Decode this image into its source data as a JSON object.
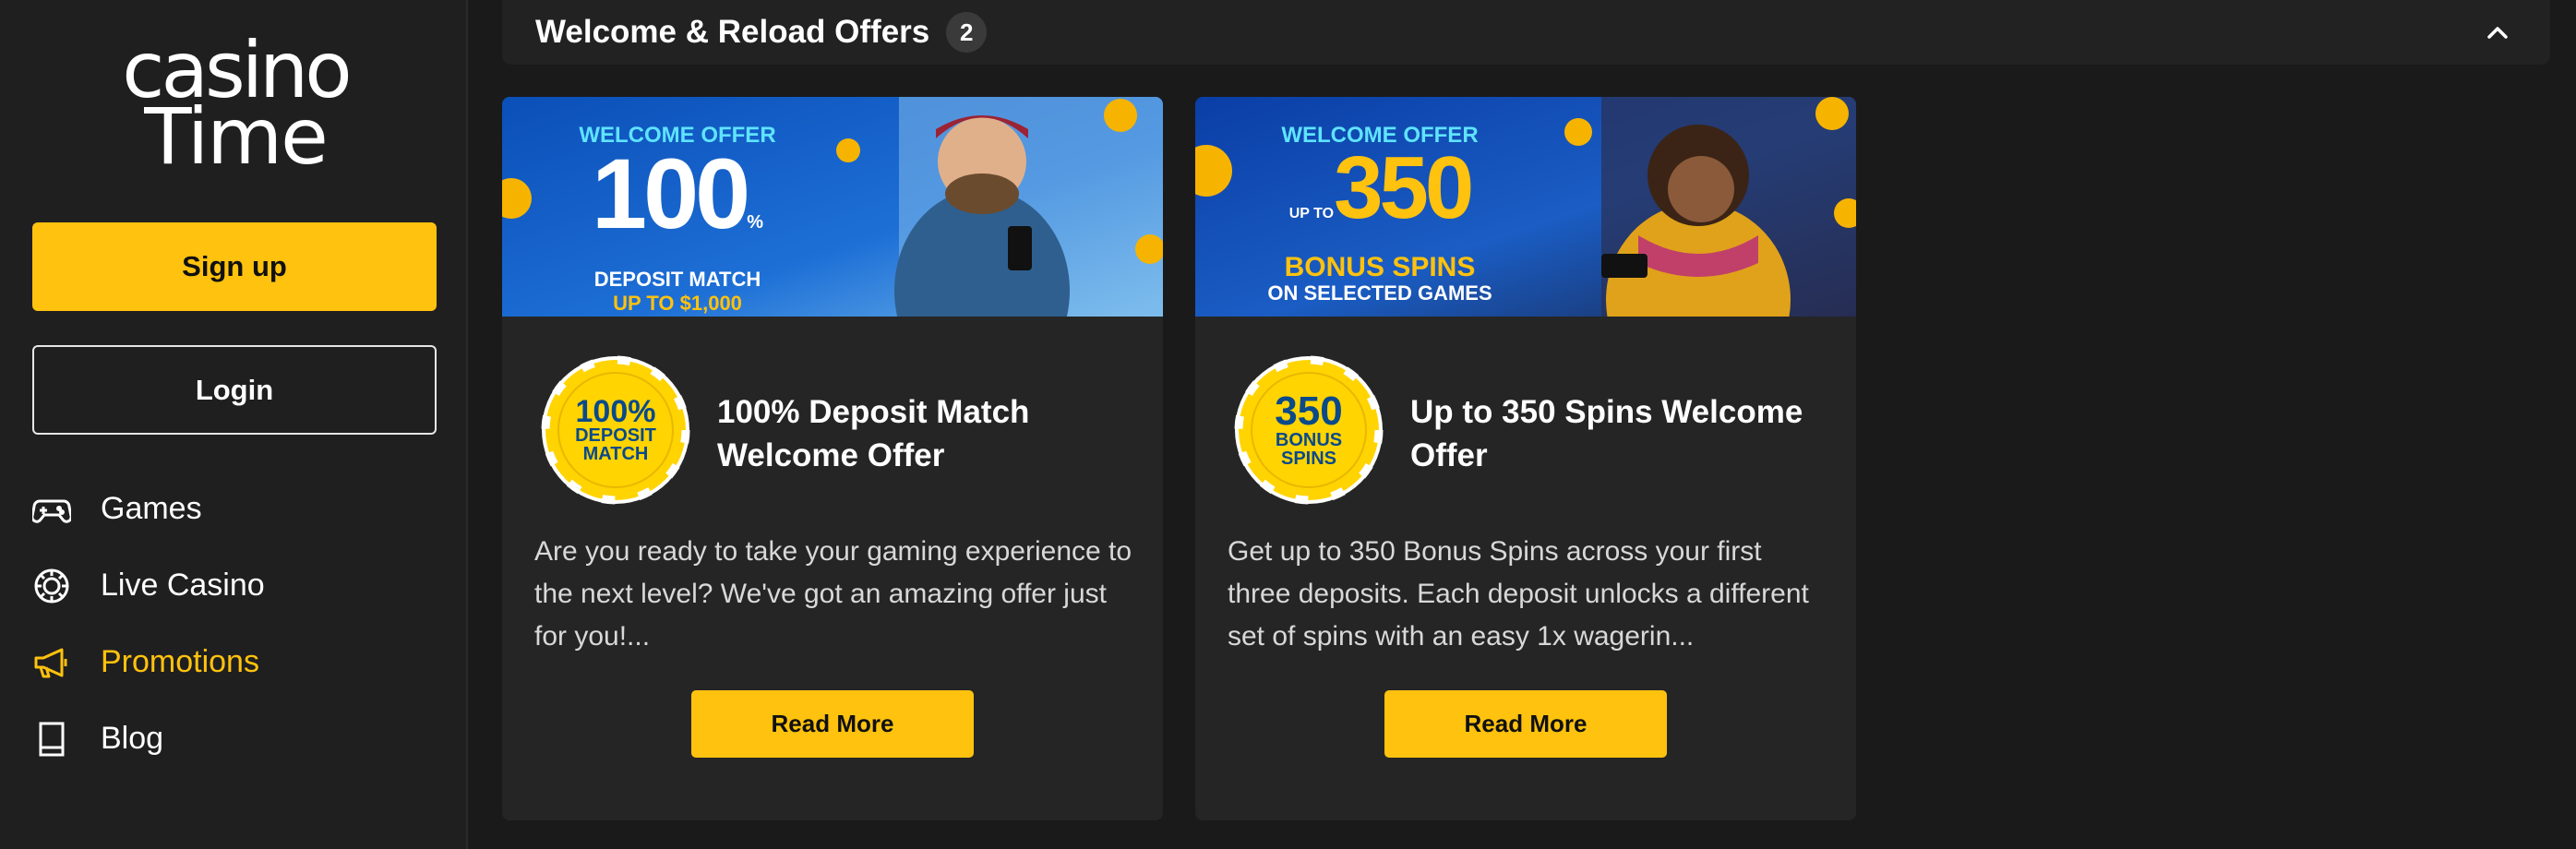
{
  "logo": {
    "line1": "casino",
    "line2": "Time"
  },
  "auth": {
    "signup_label": "Sign up",
    "login_label": "Login"
  },
  "nav": {
    "items": [
      {
        "label": "Games",
        "icon": "gamepad-icon"
      },
      {
        "label": "Live Casino",
        "icon": "poker-chip-icon"
      },
      {
        "label": "Promotions",
        "icon": "megaphone-icon",
        "active": true
      },
      {
        "label": "Blog",
        "icon": "book-icon"
      }
    ]
  },
  "section": {
    "title": "Welcome & Reload Offers",
    "count": "2"
  },
  "offers": [
    {
      "banner": {
        "top": "WELCOME OFFER",
        "big": "100",
        "pct": "%",
        "line3": "DEPOSIT MATCH",
        "line4": "UP TO $1,000"
      },
      "chip": {
        "line1": "100%",
        "line2": "DEPOSIT",
        "line3": "MATCH"
      },
      "title": "100% Deposit Match Welcome Offer",
      "description": "Are you ready to take your gaming experience to the next level? We've got an amazing offer just for you!...",
      "button": "Read More"
    },
    {
      "banner": {
        "top": "WELCOME OFFER",
        "upto": "UP TO",
        "big": "350",
        "line3": "BONUS SPINS",
        "line4": "ON SELECTED GAMES"
      },
      "chip": {
        "line1": "350",
        "line2": "BONUS",
        "line3": "SPINS"
      },
      "title": "Up to 350 Spins Welcome Offer",
      "description": "Get up to 350 Bonus Spins across your first three deposits. Each deposit unlocks a different set of spins with an easy 1x wagerin...",
      "button": "Read More"
    }
  ],
  "colors": {
    "accent": "#ffc20e",
    "sidebar_bg": "#1f1f1f",
    "card_bg": "#252525",
    "page_bg": "#1a1a1a"
  }
}
